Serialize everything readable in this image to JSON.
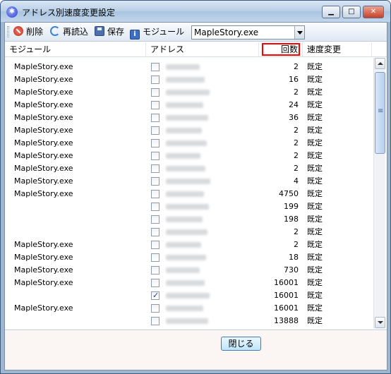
{
  "window": {
    "title": "アドレス別速度変更設定",
    "minimize": "▁",
    "maximize": "□",
    "close": "✕"
  },
  "toolbar": {
    "delete_label": "削除",
    "reload_label": "再読込",
    "save_label": "保存",
    "module_label": "モジュール",
    "module_select_value": "MapleStory.exe"
  },
  "columns": {
    "module": "モジュール",
    "address": "アドレス",
    "count": "回数",
    "speed": "速度変更"
  },
  "rows": [
    {
      "module": "MapleStory.exe",
      "checked": false,
      "count": "2",
      "speed": "既定"
    },
    {
      "module": "MapleStory.exe",
      "checked": false,
      "count": "16",
      "speed": "既定"
    },
    {
      "module": "MapleStory.exe",
      "checked": false,
      "count": "2",
      "speed": "既定"
    },
    {
      "module": "MapleStory.exe",
      "checked": false,
      "count": "24",
      "speed": "既定"
    },
    {
      "module": "MapleStory.exe",
      "checked": false,
      "count": "36",
      "speed": "既定"
    },
    {
      "module": "MapleStory.exe",
      "checked": false,
      "count": "2",
      "speed": "既定"
    },
    {
      "module": "MapleStory.exe",
      "checked": false,
      "count": "2",
      "speed": "既定"
    },
    {
      "module": "MapleStory.exe",
      "checked": false,
      "count": "2",
      "speed": "既定"
    },
    {
      "module": "MapleStory.exe",
      "checked": false,
      "count": "2",
      "speed": "既定"
    },
    {
      "module": "MapleStory.exe",
      "checked": false,
      "count": "4",
      "speed": "既定"
    },
    {
      "module": "MapleStory.exe",
      "checked": false,
      "count": "4750",
      "speed": "既定"
    },
    {
      "module": "",
      "checked": false,
      "count": "199",
      "speed": "既定"
    },
    {
      "module": "",
      "checked": false,
      "count": "198",
      "speed": "既定"
    },
    {
      "module": "",
      "checked": false,
      "count": "2",
      "speed": "既定"
    },
    {
      "module": "MapleStory.exe",
      "checked": false,
      "count": "2",
      "speed": "既定"
    },
    {
      "module": "MapleStory.exe",
      "checked": false,
      "count": "18",
      "speed": "既定"
    },
    {
      "module": "MapleStory.exe",
      "checked": false,
      "count": "730",
      "speed": "既定"
    },
    {
      "module": "MapleStory.exe",
      "checked": false,
      "count": "16001",
      "speed": "既定"
    },
    {
      "module": "",
      "checked": true,
      "count": "16001",
      "speed": "既定"
    },
    {
      "module": "MapleStory.exe",
      "checked": false,
      "count": "16001",
      "speed": "既定"
    },
    {
      "module": "",
      "checked": false,
      "count": "13888",
      "speed": "既定"
    }
  ],
  "footer": {
    "close_label": "閉じる"
  },
  "colors": {
    "highlight": "#ff0000",
    "title_bar": "#b9cfe6"
  }
}
